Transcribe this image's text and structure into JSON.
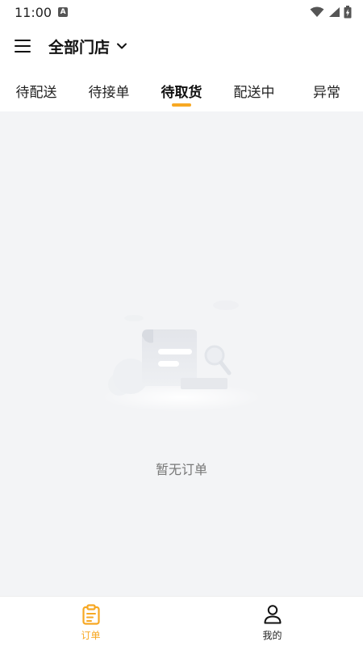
{
  "status_bar": {
    "time": "11:00",
    "a_badge": "A",
    "icons": [
      "wifi-icon",
      "signal-icon",
      "battery-icon"
    ]
  },
  "header": {
    "store_title": "全部门店",
    "menu_icon": "hamburger-menu-icon",
    "dropdown_icon": "chevron-down-icon"
  },
  "tabs": [
    {
      "label": "待配送"
    },
    {
      "label": "待接单"
    },
    {
      "label": "待取货",
      "active": true
    },
    {
      "label": "配送中"
    },
    {
      "label": "异常"
    }
  ],
  "empty_state": {
    "text": "暂无订单",
    "icon": "empty-document-illustration"
  },
  "bottom_nav": {
    "items": [
      {
        "label": "订单",
        "icon": "clipboard-icon",
        "active": true
      },
      {
        "label": "我的",
        "icon": "user-icon",
        "active": false
      }
    ]
  },
  "colors": {
    "accent": "#f7a823",
    "content_bg": "#f3f4f6",
    "text_primary": "#111111",
    "text_muted": "#777777"
  }
}
